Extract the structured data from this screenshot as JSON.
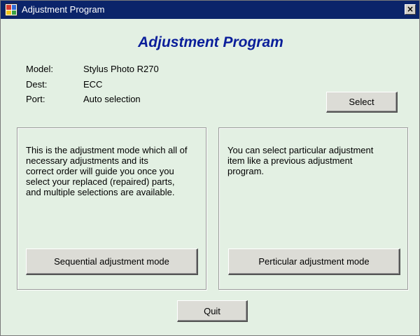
{
  "window": {
    "title": "Adjustment Program"
  },
  "header": {
    "title": "Adjustment Program"
  },
  "info": {
    "model_label": "Model:",
    "model_value": "Stylus Photo R270",
    "dest_label": "Dest:",
    "dest_value": "ECC",
    "port_label": "Port:",
    "port_value": "Auto selection"
  },
  "buttons": {
    "select": "Select",
    "sequential": "Sequential adjustment mode",
    "particular": "Perticular adjustment mode",
    "quit": "Quit"
  },
  "panels": {
    "sequential_text": "This is the adjustment mode which all of\nnecessary adjustments and its\ncorrect order will guide you once you\nselect your replaced (repaired) parts,\nand multiple selections are available.",
    "particular_text": "You can select particular adjustment\nitem like a previous adjustment\nprogram."
  },
  "icons": {
    "app": "app-icon",
    "close": "close-icon"
  },
  "colors": {
    "titlebar": "#0b246a",
    "background": "#e3f0e3",
    "title_text": "#0a1e9a"
  }
}
